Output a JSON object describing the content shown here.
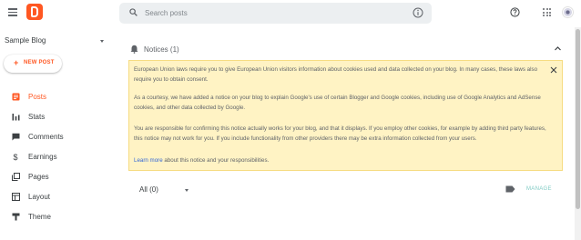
{
  "header": {
    "search": {
      "placeholder": "Search posts"
    }
  },
  "sidebar": {
    "blog_name": "Sample Blog",
    "new_post_label": "NEW POST",
    "items": [
      {
        "label": "Posts",
        "icon": "posts-icon",
        "active": true
      },
      {
        "label": "Stats",
        "icon": "stats-icon"
      },
      {
        "label": "Comments",
        "icon": "comments-icon"
      },
      {
        "label": "Earnings",
        "icon": "earnings-icon"
      },
      {
        "label": "Pages",
        "icon": "pages-icon"
      },
      {
        "label": "Layout",
        "icon": "layout-icon"
      },
      {
        "label": "Theme",
        "icon": "theme-icon"
      }
    ]
  },
  "main": {
    "notices_title": "Notices (1)",
    "notice": {
      "p1": "European Union laws require you to give European Union visitors information about cookies used and data collected on your blog. In many cases, these laws also require you to obtain consent.",
      "p2": "As a courtesy, we have added a notice on your blog to explain Google's use of certain Blogger and Google cookies, including use of Google Analytics and AdSense cookies, and other data collected by Google.",
      "p3": "You are responsible for confirming this notice actually works for your blog, and that it displays. If you employ other cookies, for example by adding third party features, this notice may not work for you. If you include functionality from other providers there may be extra information collected from your users.",
      "learn_more": "Learn more",
      "p4_rest": " about this notice and your responsibilities."
    },
    "filter_label": "All (0)",
    "manage_label": "MANAGE"
  },
  "colors": {
    "brand": "#ff5722",
    "notice_bg": "#fff3c4",
    "link": "#3367d6",
    "manage": "#80cbc4"
  }
}
